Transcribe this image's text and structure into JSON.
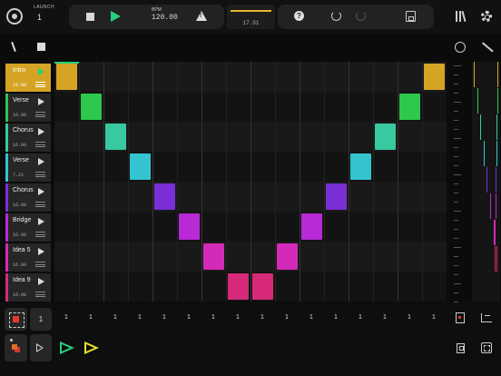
{
  "header": {
    "launch_label": "LAUNCH",
    "launch_value": "1",
    "bpm_label": "BPM",
    "bpm_value": "120.00",
    "position": "17.91",
    "help_label": "?"
  },
  "scenes": [
    {
      "name": "Intro",
      "time": "16.00",
      "color": "#d6a424",
      "active": true
    },
    {
      "name": "Verse",
      "time": "16.00",
      "color": "#2ec84c",
      "active": false
    },
    {
      "name": "Chorus",
      "time": "16.00",
      "color": "#38c9a0",
      "active": false
    },
    {
      "name": "Verse",
      "time": "7.21",
      "color": "#34c4cf",
      "active": false
    },
    {
      "name": "Chorus",
      "time": "16.00",
      "color": "#7a2fd6",
      "active": false
    },
    {
      "name": "Bridge",
      "time": "16.00",
      "color": "#b82ad6",
      "active": false
    },
    {
      "name": "Idea 5",
      "time": "16.00",
      "color": "#d42ab8",
      "active": false
    },
    {
      "name": "Idea 9",
      "time": "16.00",
      "color": "#d62a78",
      "active": false
    }
  ],
  "bar_lengths": [
    "1",
    "1",
    "1",
    "1",
    "1",
    "1",
    "1",
    "1",
    "1",
    "1",
    "1",
    "1",
    "1",
    "1",
    "1",
    "1"
  ],
  "length_value": "1",
  "colors": {
    "accent_green": "#25d07a",
    "accent_yellow": "#e8e030",
    "record_red": "#e23b2b",
    "playhead_yellow": "#e8b730"
  },
  "icons": {
    "record_mode": "circle-icon",
    "stop": "stop-icon",
    "play": "play-icon",
    "warning": "warning-icon",
    "help": "help-icon",
    "undo": "undo-icon",
    "redo": "redo-icon",
    "save": "save-icon",
    "library": "library-icon",
    "settings": "gear-icon"
  }
}
